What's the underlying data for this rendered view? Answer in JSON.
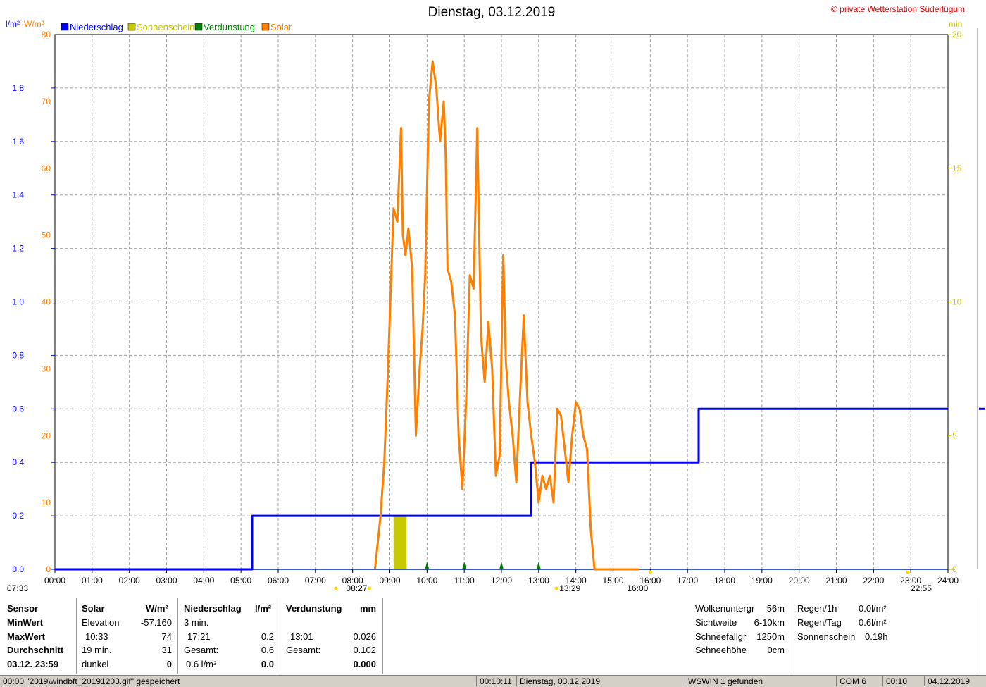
{
  "chart_data": {
    "type": "line",
    "title": "Dienstag, 03.12.2019",
    "copyright": "© private Wetterstation Süderlügum",
    "left_axis_units": [
      "l/m²",
      "W/m²"
    ],
    "right_axis_unit": "min",
    "x_ticks": [
      "00:00",
      "01:00",
      "02:00",
      "03:00",
      "04:00",
      "05:00",
      "06:00",
      "07:00",
      "08:00",
      "09:00",
      "10:00",
      "11:00",
      "12:00",
      "13:00",
      "14:00",
      "15:00",
      "16:00",
      "17:00",
      "18:00",
      "19:00",
      "20:00",
      "21:00",
      "22:00",
      "23:00",
      "24:00"
    ],
    "y_precip_ticks": [
      "0.0",
      "0.2",
      "0.4",
      "0.6",
      "0.8",
      "1.0",
      "1.2",
      "1.4",
      "1.6",
      "1.8"
    ],
    "y_precip_range": [
      0,
      2.0
    ],
    "y_solar_ticks": [
      "0",
      "10",
      "20",
      "30",
      "40",
      "50",
      "60",
      "70",
      "80"
    ],
    "y_solar_range": [
      0,
      80
    ],
    "y_min_ticks": [
      "0",
      "5",
      "10",
      "15",
      "20"
    ],
    "y_min_range": [
      0,
      20
    ],
    "legend": [
      {
        "label": "Niederschlag",
        "color": "#0000ff"
      },
      {
        "label": "Sonnenschein",
        "color": "#c8c800"
      },
      {
        "label": "Verdunstung",
        "color": "#008000"
      },
      {
        "label": "Solar",
        "color": "#ff8000"
      }
    ],
    "sun_markers": [
      {
        "label": "07:33",
        "hour": 7.55
      },
      {
        "label": "08:27",
        "hour": 8.45
      },
      {
        "label": "13:29",
        "hour": 13.48
      },
      {
        "label": "16:00",
        "hour": 16.0
      },
      {
        "label": "22:55",
        "hour": 22.92
      }
    ],
    "series": [
      {
        "name": "Niederschlag",
        "color": "#0000ff",
        "x": [
          0,
          5.3,
          5.3,
          12.8,
          12.8,
          17.3,
          17.3,
          24
        ],
        "y": [
          0.0,
          0.0,
          0.2,
          0.2,
          0.4,
          0.4,
          0.6,
          0.6
        ]
      },
      {
        "name": "Solar",
        "color": "#ff8000",
        "x": [
          8.6,
          8.75,
          8.85,
          8.95,
          9.1,
          9.2,
          9.3,
          9.35,
          9.42,
          9.5,
          9.6,
          9.7,
          9.8,
          9.88,
          9.95,
          10.05,
          10.15,
          10.25,
          10.35,
          10.45,
          10.5,
          10.55,
          10.65,
          10.75,
          10.85,
          10.95,
          11.05,
          11.15,
          11.25,
          11.35,
          11.45,
          11.55,
          11.65,
          11.75,
          11.85,
          11.95,
          12.05,
          12.12,
          12.2,
          12.3,
          12.4,
          12.5,
          12.6,
          12.7,
          12.8,
          12.9,
          13.0,
          13.1,
          13.2,
          13.3,
          13.4,
          13.5,
          13.6,
          13.7,
          13.8,
          13.9,
          14.0,
          14.1,
          14.2,
          14.3,
          14.4,
          14.5,
          14.6,
          14.7,
          14.8,
          14.9,
          15.0,
          15.1,
          15.2,
          15.3,
          15.4,
          15.5,
          15.6,
          15.7
        ],
        "y": [
          0,
          8,
          16,
          30,
          54,
          52,
          66,
          50,
          47,
          51,
          45,
          20,
          30,
          36,
          44,
          70,
          76,
          72,
          64,
          70,
          62,
          45,
          43,
          38,
          20,
          12,
          25,
          44,
          42,
          66,
          35,
          28,
          37,
          30,
          14,
          17,
          47,
          31,
          25,
          20,
          13,
          26,
          38,
          25,
          20,
          16,
          10,
          14,
          12,
          14,
          10,
          24,
          23,
          18,
          13,
          20,
          25,
          24,
          20,
          18,
          6,
          0,
          0,
          0,
          0,
          0,
          0,
          0,
          0,
          0,
          0,
          0,
          0,
          0
        ]
      }
    ],
    "sunshine_bars": [
      {
        "start": 9.1,
        "end": 9.45,
        "minutes": 2
      }
    ],
    "evaporation_marks": [
      10.0,
      11.0,
      12.0,
      13.0
    ]
  },
  "stats": {
    "sensor_header": "Sensor",
    "row_labels": [
      "MinWert",
      "MaxWert",
      "Durchschnitt",
      "03.12. 23:59"
    ],
    "solar": {
      "header": "Solar",
      "unit": "W/m²",
      "rows": [
        [
          "Elevation",
          "-57.160"
        ],
        [
          "10:33",
          "74"
        ],
        [
          "19 min.",
          "31"
        ],
        [
          "dunkel",
          "0"
        ]
      ]
    },
    "precip": {
      "header": "Niederschlag",
      "unit": "l/m²",
      "rows": [
        [
          "3 min.",
          ""
        ],
        [
          "17:21",
          "0.2"
        ],
        [
          "Gesamt:",
          "0.6"
        ],
        [
          "0.6 l/m²",
          "0.0"
        ]
      ]
    },
    "evap": {
      "header": "Verdunstung",
      "unit": "mm",
      "rows": [
        [
          "",
          ""
        ],
        [
          "13:01",
          "0.026"
        ],
        [
          "Gesamt:",
          "0.102"
        ],
        [
          "",
          "0.000"
        ]
      ]
    },
    "weather": [
      [
        "Wolkenuntergr",
        "56m"
      ],
      [
        "Sichtweite",
        "6-10km"
      ],
      [
        "Schneefallgr",
        "1250m"
      ],
      [
        "Schneehöhe",
        "0cm"
      ]
    ],
    "rain": [
      [
        "Regen/1h",
        "0.0l/m²"
      ],
      [
        "Regen/Tag",
        "0.6l/m²"
      ],
      [
        "Sonnenschein",
        "0.19h"
      ]
    ]
  },
  "statusbar": {
    "message": "00:00 \"2019\\windbft_20191203.gif\" gespeichert",
    "time": "00:10:11",
    "date_label": "Dienstag, 03.12.2019",
    "device": "WSWIN 1 gefunden",
    "port": "COM 6",
    "clock": "00:10",
    "date": "04.12.2019"
  }
}
